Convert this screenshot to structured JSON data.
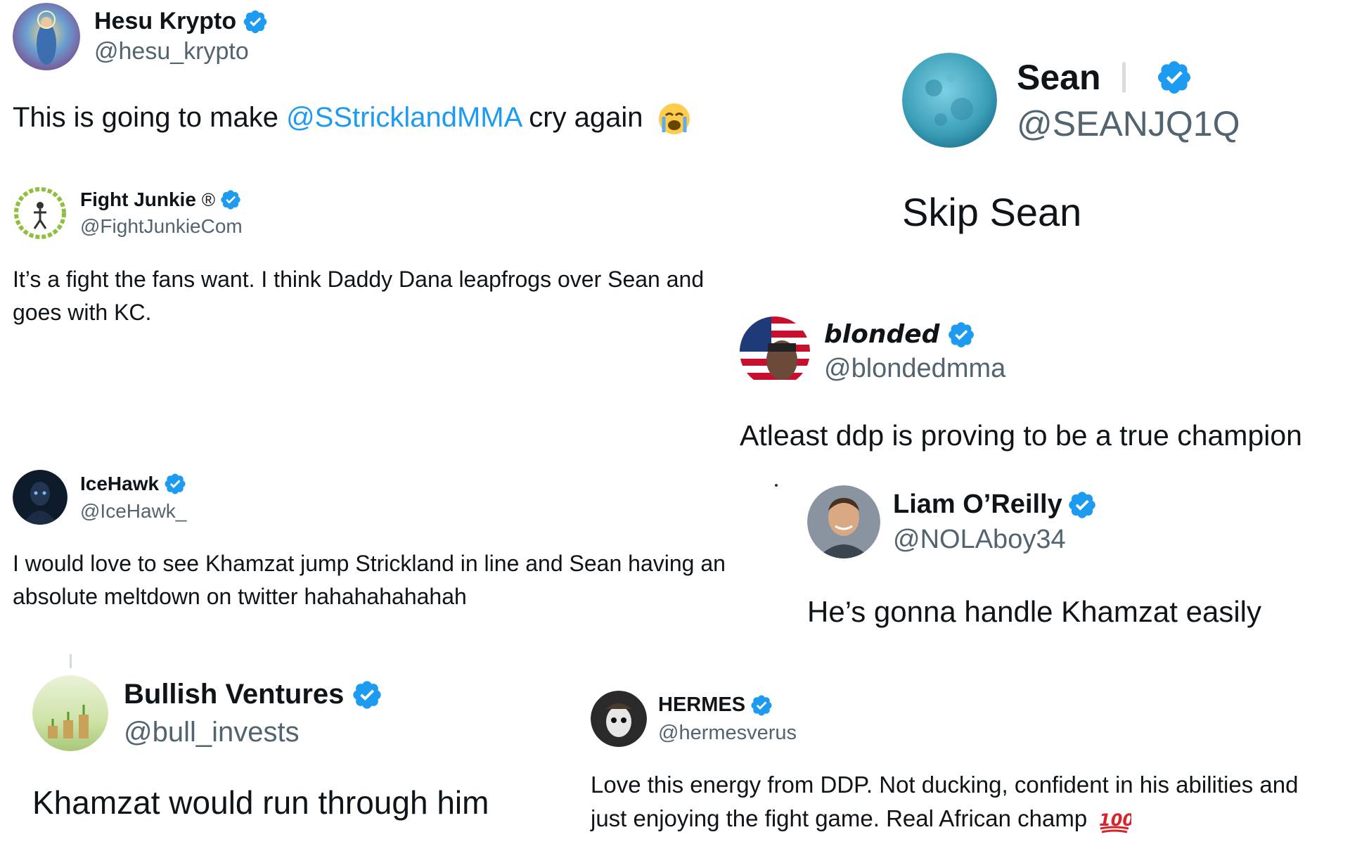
{
  "tweets": {
    "hesu": {
      "name": "Hesu Krypto",
      "handle": "@hesu_krypto",
      "text_before": "This is going to make ",
      "mention": "@SStricklandMMA",
      "text_after": " cry again",
      "emoji": "loudly-crying-face-icon"
    },
    "sean": {
      "name": "Sean",
      "handle": "@SEANJQ1Q",
      "text": "Skip Sean"
    },
    "fightjunkie": {
      "name": "Fight Junkie",
      "registered": "®",
      "handle": "@FightJunkieCom",
      "text_line1": "It’s a fight the fans want. I think Daddy Dana leapfrogs over Sean and",
      "text_line2": "goes with KC."
    },
    "blonded": {
      "name": "blonded",
      "handle": "@blondedmma",
      "text": "Atleast ddp is proving to be a true champion"
    },
    "icehawk": {
      "name": "IceHawk",
      "handle": "@IceHawk_",
      "text_line1": "I would love to see Khamzat jump Strickland in line and Sean having an",
      "text_line2": "absolute meltdown on twitter hahahahahahah"
    },
    "liam": {
      "name": "Liam O’Reilly",
      "handle": "@NOLAboy34",
      "text": "He’s gonna handle Khamzat easily"
    },
    "bullish": {
      "name": "Bullish Ventures",
      "handle": "@bull_invests",
      "text": "Khamzat would run through him"
    },
    "hermes": {
      "name": "HERMES",
      "handle": "@hermesverus",
      "text_line1": "Love this energy from DDP. Not ducking, confident in his abilities and",
      "text_line2": "just enjoying the fight game. Real African champ",
      "emoji": "hundred-points-icon"
    }
  },
  "colors": {
    "verified": "#1d9bf0",
    "mention": "#1d9bf0",
    "handle": "#536471",
    "text": "#0f1419"
  }
}
